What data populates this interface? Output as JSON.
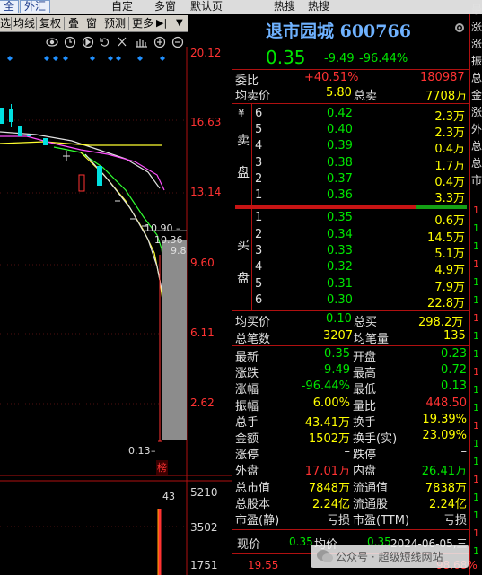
{
  "top_strip": {
    "left_tab": "全",
    "outer_tab": "外汇",
    "menu_items": [
      "自定",
      "多窗",
      "默认页",
      "热搜",
      "热搜"
    ]
  },
  "toolbar": {
    "items": [
      "选",
      "均线",
      "复权",
      "叠",
      "窗",
      "预测",
      "更多"
    ]
  },
  "chart": {
    "price_scale": [
      "20.12",
      "16.63",
      "13.14",
      "9.60",
      "6.11",
      "2.62"
    ],
    "volume_scale": [
      "5210",
      "3502",
      "1751"
    ],
    "annotations": {
      "high_label": "10.90",
      "mid_label": "10.36",
      "low_label": "9.8",
      "min_label": "0.13",
      "vol_label": "43",
      "badge": "榜"
    }
  },
  "quote": {
    "title": "退市园城 600766",
    "price": "0.35",
    "change": "-9.49",
    "change_pct": "-96.44%",
    "webi_label": "委比",
    "webi_value": "+40.51%",
    "webi_count": "180987",
    "avg_sell_label": "均卖价",
    "avg_sell_value": "5.80",
    "total_sell_label": "总卖",
    "total_sell_value": "7708万",
    "sell_side_label": [
      "¥",
      "卖",
      "盘"
    ],
    "sell_levels": [
      {
        "lvl": "6",
        "price": "0.42",
        "vol": "2.3万"
      },
      {
        "lvl": "5",
        "price": "0.40",
        "vol": "2.3万"
      },
      {
        "lvl": "4",
        "price": "0.39",
        "vol": "0.4万"
      },
      {
        "lvl": "3",
        "price": "0.38",
        "vol": "1.7万"
      },
      {
        "lvl": "2",
        "price": "0.37",
        "vol": "0.4万"
      },
      {
        "lvl": "1",
        "price": "0.36",
        "vol": "3.3万"
      }
    ],
    "buy_side_label": [
      "买",
      "盘"
    ],
    "buy_levels": [
      {
        "lvl": "1",
        "price": "0.35",
        "vol": "0.6万"
      },
      {
        "lvl": "2",
        "price": "0.34",
        "vol": "14.5万"
      },
      {
        "lvl": "3",
        "price": "0.33",
        "vol": "5.1万"
      },
      {
        "lvl": "4",
        "price": "0.32",
        "vol": "4.9万"
      },
      {
        "lvl": "5",
        "price": "0.31",
        "vol": "7.9万"
      },
      {
        "lvl": "6",
        "price": "0.30",
        "vol": "22.8万"
      }
    ],
    "avg_buy_label": "均买价",
    "avg_buy_value": "0.10",
    "total_buy_label": "总买",
    "total_buy_value": "298.2万",
    "trades_label": "总笔数",
    "trades_value": "3207",
    "avg_vol_label": "均笔量",
    "avg_vol_value": "135",
    "stats": [
      {
        "l1": "最新",
        "v1": "0.35",
        "c1": "green",
        "l2": "开盘",
        "v2": "0.23",
        "c2": "green"
      },
      {
        "l1": "涨跌",
        "v1": "-9.49",
        "c1": "green",
        "l2": "最高",
        "v2": "0.72",
        "c2": "green"
      },
      {
        "l1": "涨幅",
        "v1": "-96.44%",
        "c1": "green",
        "l2": "最低",
        "v2": "0.13",
        "c2": "green"
      },
      {
        "l1": "振幅",
        "v1": "6.00%",
        "c1": "yellow",
        "l2": "量比",
        "v2": "448.50",
        "c2": "red"
      },
      {
        "l1": "总手",
        "v1": "43.41万",
        "c1": "yellow",
        "l2": "换手",
        "v2": "19.39%",
        "c2": "yellow"
      },
      {
        "l1": "金额",
        "v1": "1502万",
        "c1": "yellow",
        "l2": "换手(实)",
        "v2": "23.09%",
        "c2": "yellow"
      },
      {
        "l1": "涨停",
        "v1": "–",
        "c1": "white",
        "l2": "跌停",
        "v2": "–",
        "c2": "white"
      },
      {
        "l1": "外盘",
        "v1": "17.01万",
        "c1": "red",
        "l2": "内盘",
        "v2": "26.41万",
        "c2": "green"
      },
      {
        "l1": "总市值",
        "v1": "7848万",
        "c1": "yellow",
        "l2": "流通值",
        "v2": "7838万",
        "c2": "yellow"
      },
      {
        "l1": "总股本",
        "v1": "2.24亿",
        "c1": "yellow",
        "l2": "流通股",
        "v2": "2.24亿",
        "c2": "yellow"
      },
      {
        "l1": "市盈(静)",
        "v1": "亏损",
        "c1": "white",
        "l2": "市盈(TTM)",
        "v2": "亏损",
        "c2": "white"
      }
    ],
    "bottom": {
      "now_label": "现价",
      "now_value": "0.35",
      "avg_label": "均价",
      "avg_value": "0.35",
      "date": "2024-06-05,三",
      "left_num": "19.55",
      "right_num": "98.68%"
    },
    "watermark": "公众号 · 超级短线网站"
  },
  "side_strip": [
    "最",
    "涨",
    "涨",
    "振",
    "总",
    "金",
    "涨",
    "外",
    "总",
    "总",
    "市"
  ],
  "side_nums": [
    "1",
    "1",
    "1",
    "1",
    "1",
    "1",
    "1",
    "1",
    "1",
    "1",
    "1",
    "1",
    "1",
    "1",
    "1",
    "1",
    "1",
    "1",
    "1",
    "1"
  ]
}
